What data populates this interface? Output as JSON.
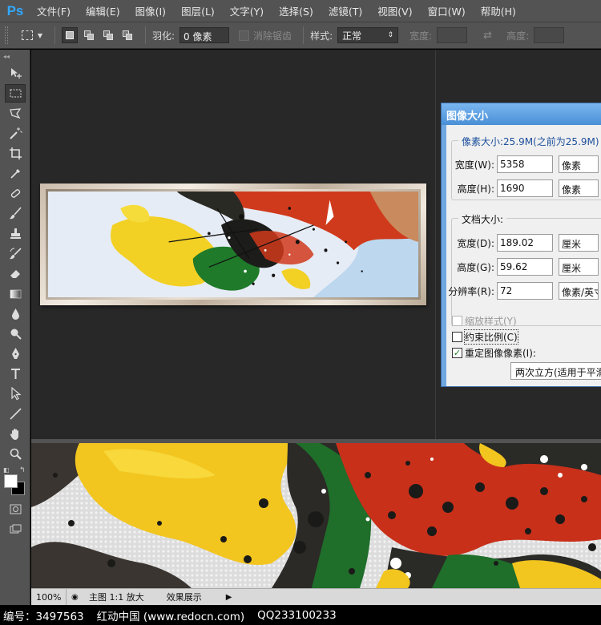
{
  "app": {
    "logo": "Ps",
    "menu": [
      "文件(F)",
      "编辑(E)",
      "图像(I)",
      "图层(L)",
      "文字(Y)",
      "选择(S)",
      "滤镜(T)",
      "视图(V)",
      "窗口(W)",
      "帮助(H)"
    ]
  },
  "options": {
    "feather_label": "羽化:",
    "feather_value": "0 像素",
    "antialias_label": "消除锯齿",
    "style_label": "样式:",
    "style_value": "正常",
    "width_label": "宽度:",
    "height_label": "高度:"
  },
  "dialog": {
    "title": "图像大小",
    "pixel_group_title": "像素大小:25.9M(之前为25.9M)",
    "pixel_width_label": "宽度(W):",
    "pixel_width_value": "5358",
    "pixel_width_unit": "像素",
    "pixel_height_label": "高度(H):",
    "pixel_height_value": "1690",
    "pixel_height_unit": "像素",
    "doc_group_title": "文档大小:",
    "doc_width_label": "宽度(D):",
    "doc_width_value": "189.02",
    "doc_width_unit": "厘米",
    "doc_height_label": "高度(G):",
    "doc_height_value": "59.62",
    "doc_height_unit": "厘米",
    "resolution_label": "分辨率(R):",
    "resolution_value": "72",
    "resolution_unit": "像素/英寸",
    "scale_styles_label": "缩放样式(Y)",
    "constrain_label": "约束比例(C)",
    "resample_label": "重定图像像素(I):",
    "resample_value": "两次立方(适用于平滑渐变)"
  },
  "status": {
    "zoom": "100%",
    "doc_info": "主图 1:1 放大",
    "effect": "效果展示"
  },
  "footer": {
    "id_text": "编号：3497563",
    "site_text": "红动中国 (www.redocn.com)",
    "qq_text": "QQ233100233"
  },
  "colors": {
    "ui_panel": "#535353",
    "workspace": "#282828",
    "ps_blue": "#31a8ff",
    "dialog_title": "#4a8fd6",
    "paint_red": "#d03a1c",
    "paint_yellow": "#f2d024",
    "paint_green": "#1f7a2a"
  },
  "tools": [
    "move-icon",
    "rect-marquee-icon",
    "lasso-icon",
    "magic-wand-icon",
    "crop-icon",
    "eyedropper-icon",
    "healing-brush-icon",
    "brush-icon",
    "clone-stamp-icon",
    "history-brush-icon",
    "eraser-icon",
    "gradient-icon",
    "blur-icon",
    "dodge-icon",
    "pen-icon",
    "type-icon",
    "path-select-icon",
    "line-icon",
    "hand-icon",
    "zoom-icon"
  ]
}
